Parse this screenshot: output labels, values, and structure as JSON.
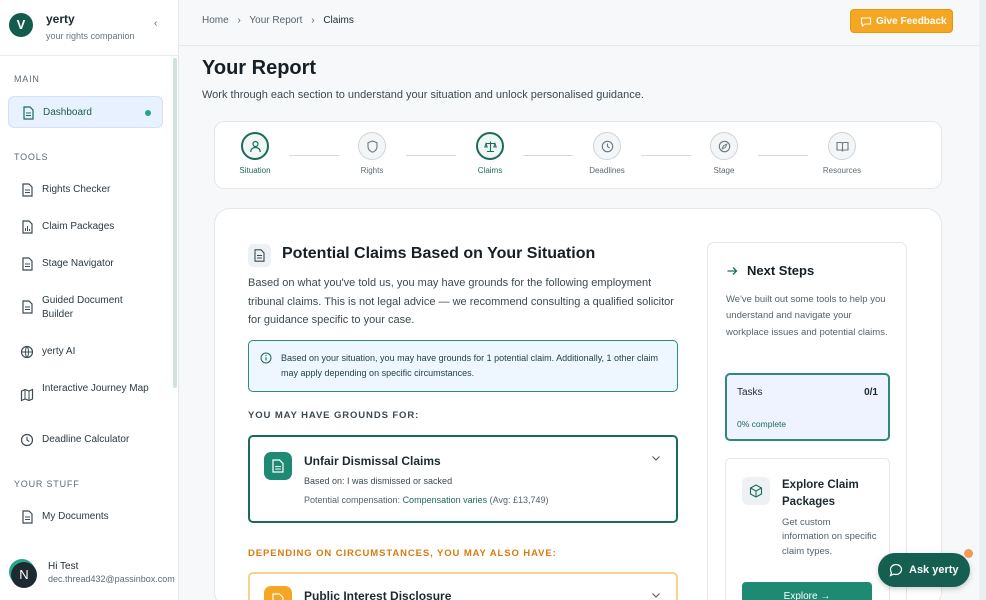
{
  "brand": {
    "name": "yerty",
    "tagline": "your rights companion",
    "logo_letter": "V"
  },
  "sidebar": {
    "main_label": "MAIN",
    "tools_label": "TOOLS",
    "stuff_label": "YOUR STUFF",
    "main_items": [
      {
        "label": "Dashboard",
        "icon": "document-icon"
      }
    ],
    "tools_items": [
      {
        "label": "Rights Checker",
        "icon": "document-icon"
      },
      {
        "label": "Claim Packages",
        "icon": "chart-document-icon"
      },
      {
        "label": "Stage Navigator",
        "icon": "document-icon"
      },
      {
        "label": "Guided Document Builder",
        "icon": "document-icon"
      },
      {
        "label": "yerty AI",
        "icon": "globe-icon"
      },
      {
        "label": "Interactive Journey Map",
        "icon": "map-icon"
      },
      {
        "label": "Deadline Calculator",
        "icon": "clock-icon"
      }
    ],
    "stuff_items": [
      {
        "label": "My Documents",
        "icon": "document-icon"
      }
    ]
  },
  "user": {
    "avatar_letter": "N",
    "name": "Hi Test",
    "email": "dec.thread432@passinbox.com"
  },
  "breadcrumb": {
    "home": "Home",
    "report": "Your Report",
    "current": "Claims",
    "sep": "›"
  },
  "feedback_button": "Give Feedback",
  "page": {
    "title": "Your Report",
    "subtitle": "Work through each section to understand your situation and unlock personalised guidance."
  },
  "steps": [
    {
      "label": "Situation",
      "icon": "user-icon",
      "active": true
    },
    {
      "label": "Rights",
      "icon": "shield-icon",
      "active": false
    },
    {
      "label": "Claims",
      "icon": "scales-icon",
      "active": true
    },
    {
      "label": "Deadlines",
      "icon": "clock-icon",
      "active": false
    },
    {
      "label": "Stage",
      "icon": "compass-icon",
      "active": false
    },
    {
      "label": "Resources",
      "icon": "book-icon",
      "active": false
    }
  ],
  "claims_section": {
    "title": "Potential Claims Based on Your Situation",
    "description": "Based on what you've told us, you may have grounds for the following employment tribunal claims. This is not legal advice — we recommend consulting a qualified solicitor for guidance specific to your case.",
    "info": "Based on your situation, you may have grounds for 1 potential claim. Additionally, 1 other claim may apply depending on specific circumstances.",
    "grounds_label": "YOU MAY HAVE GROUNDS FOR:",
    "depending_label": "DEPENDING ON CIRCUMSTANCES, YOU MAY ALSO HAVE:",
    "main_claim": {
      "title": "Unfair Dismissal Claims",
      "based_on": "Based on: I was dismissed or sacked",
      "comp_label": "Potential compensation: ",
      "comp_value": "Compensation varies",
      "comp_avg": " (Avg: £13,749)"
    },
    "alt_claim": {
      "title": "Public Interest Disclosure"
    }
  },
  "next_steps": {
    "title": "Next Steps",
    "description": "We've built out some tools to help you understand and navigate your workplace issues and potential claims.",
    "tasks": {
      "label": "Tasks",
      "count": "0/1",
      "progress_text": "0% complete",
      "progress": 0
    },
    "explore": {
      "title": "Explore Claim Packages",
      "description": "Get custom information on specific claim types.",
      "button": "Explore  →"
    }
  },
  "ask_button": "Ask yerty",
  "colors": {
    "primary": "#1b6b5c",
    "accent": "#f5a623",
    "info_bg": "#eef6ff"
  }
}
